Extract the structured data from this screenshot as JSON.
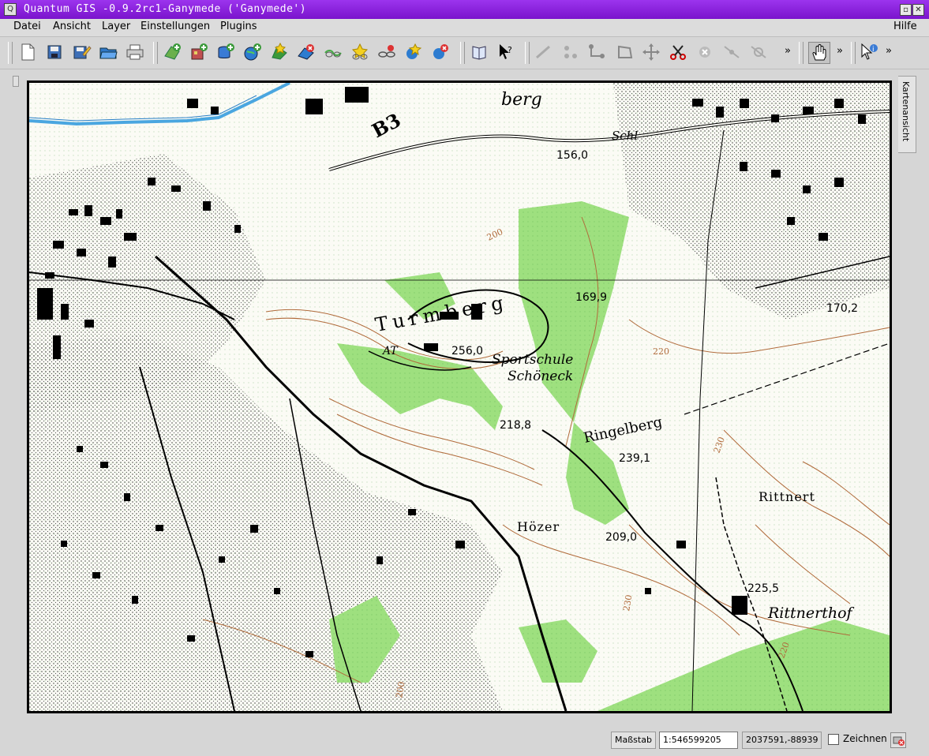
{
  "window": {
    "title": "Quantum GIS -0.9.2rc1-Ganymede ('Ganymede')",
    "controls": [
      "minimize-icon",
      "close-icon"
    ],
    "accent_color": "#8b2bd6"
  },
  "menubar": {
    "items": [
      "Datei",
      "Ansicht",
      "Layer",
      "Einstellungen",
      "Plugins"
    ],
    "help": "Hilfe"
  },
  "toolbar": {
    "file_icons": [
      "new-project-icon",
      "save-icon",
      "save-as-icon",
      "open-project-icon",
      "print-icon"
    ],
    "layer_icons": [
      "add-vector-layer-icon",
      "add-raster-layer-icon",
      "add-postgis-layer-icon",
      "add-wms-layer-icon",
      "new-vector-layer-icon",
      "remove-layer-icon",
      "show-all-layers-icon",
      "hide-all-layers-icon",
      "overview-add-icon",
      "overview-remove-icon",
      "in-overview-icon",
      "in-overview-remove-icon"
    ],
    "help_icons": [
      "help-book-icon",
      "whats-this-icon"
    ],
    "edit_icons": [
      "capture-line-icon",
      "capture-point-icon",
      "capture-line2-icon",
      "capture-polygon-icon",
      "move-vertex-icon",
      "cut-features-icon",
      "delete-feature-icon",
      "split-icon",
      "delete-vertex-icon"
    ],
    "overflow": "»",
    "pan_icon": "pan-hand-icon",
    "identify_icon": "identify-icon"
  },
  "overview_tab": {
    "label": "Kartenansicht"
  },
  "map": {
    "labels": [
      "berg",
      "B3",
      "Schl",
      "156,0",
      "200",
      "169,9",
      "170,2",
      "Turmberg",
      "256,0",
      "AT",
      "Sportschule",
      "Schöneck",
      "220",
      "218,8",
      "Ringelberg",
      "239,1",
      "230",
      "Rittnert",
      "Hözer",
      "209,0",
      "225,5",
      "Rittnerthof",
      "220",
      "200",
      "230"
    ]
  },
  "statusbar": {
    "scale_label": "Maßstab",
    "scale_value": "1:546599205",
    "coordinates": "2037591,-88939",
    "render_label": "Zeichnen",
    "render_checked": false,
    "stop_icon": "stop-render-icon"
  }
}
